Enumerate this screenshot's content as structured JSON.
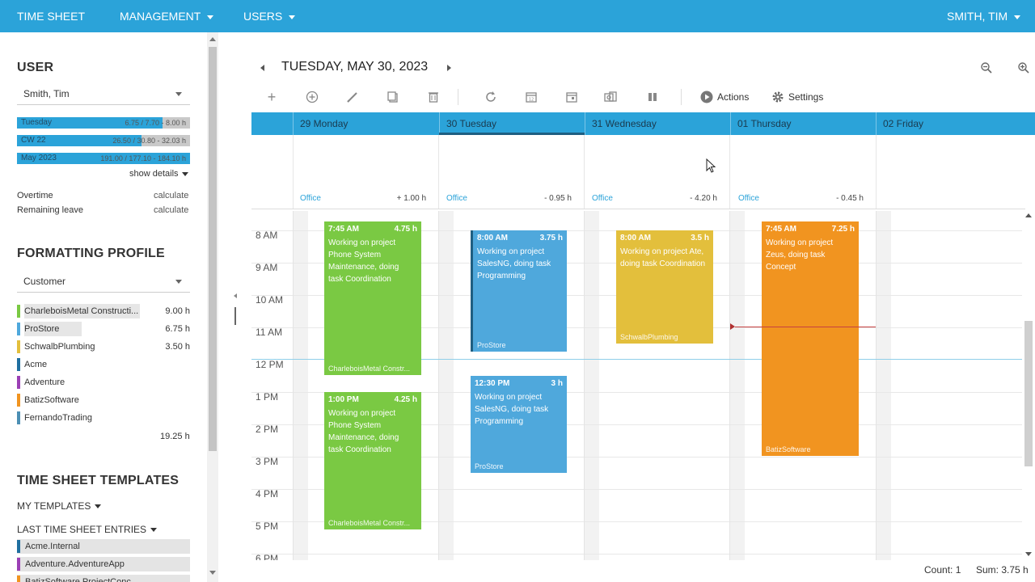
{
  "nav": {
    "timesheet": "TIME SHEET",
    "management": "MANAGEMENT",
    "users": "USERS",
    "user_menu": "SMITH, TIM"
  },
  "sidebar": {
    "user_title": "USER",
    "user_select": "Smith, Tim",
    "bars": [
      {
        "label": "Tuesday",
        "value": "6.75 / 7.70 - 8.00 h",
        "fill": 0.84
      },
      {
        "label": "CW 22",
        "value": "26.50 / 30.80 - 32.03 h",
        "fill": 0.72
      },
      {
        "label": "May 2023",
        "value": "191.00 / 177.10 - 184.10 h",
        "fill": 1.0
      }
    ],
    "show_details": "show details",
    "overtime_label": "Overtime",
    "overtime_value": "calculate",
    "leave_label": "Remaining leave",
    "leave_value": "calculate",
    "format_title": "FORMATTING PROFILE",
    "format_select": "Customer",
    "customers": [
      {
        "name": "CharleboisMetal Constructi...",
        "hours": "9.00 h",
        "color": "#7ac943"
      },
      {
        "name": "ProStore",
        "hours": "6.75 h",
        "color": "#4fa8dc"
      },
      {
        "name": "SchwalbPlumbing",
        "hours": "3.50 h",
        "color": "#e3bf3c"
      },
      {
        "name": "Acme",
        "hours": "",
        "color": "#1f6fa0"
      },
      {
        "name": "Adventure",
        "hours": "",
        "color": "#9b3fb5"
      },
      {
        "name": "BatizSoftware",
        "hours": "",
        "color": "#f19420"
      },
      {
        "name": "FernandoTrading",
        "hours": "",
        "color": "#4c8fb4"
      }
    ],
    "total_hours": "19.25 h",
    "templates_title": "TIME SHEET TEMPLATES",
    "my_templates": "MY TEMPLATES",
    "last_entries": "LAST TIME SHEET ENTRIES",
    "templates": [
      {
        "name": "Acme.Internal",
        "color": "#1f6fa0"
      },
      {
        "name": "Adventure.AdventureApp",
        "color": "#9b3fb5"
      },
      {
        "name": "BatizSoftware.ProjectConc...",
        "color": "#f19420"
      }
    ]
  },
  "calendar": {
    "date_title": "TUESDAY, MAY 30, 2023",
    "actions": "Actions",
    "settings": "Settings",
    "days": [
      {
        "label": "29 Monday",
        "office": "Office",
        "hours": "+ 1.00 h"
      },
      {
        "label": "30 Tuesday",
        "office": "Office",
        "hours": "- 0.95 h"
      },
      {
        "label": "31 Wednesday",
        "office": "Office",
        "hours": "- 4.20 h"
      },
      {
        "label": "01 Thursday",
        "office": "Office",
        "hours": "- 0.45 h"
      },
      {
        "label": "02 Friday",
        "office": "",
        "hours": ""
      }
    ],
    "hours": [
      "8 AM",
      "9 AM",
      "10 AM",
      "11 AM",
      "12 PM",
      "1 PM",
      "2 PM",
      "3 PM",
      "4 PM",
      "5 PM",
      "6 PM"
    ],
    "events": [
      {
        "day": 0,
        "time": "7:45 AM",
        "hours": "4.75 h",
        "desc": "Working on project Phone System Maintenance, doing task Coordination",
        "customer": "CharleboisMetal Constr...",
        "color": "#7ac943"
      },
      {
        "day": 0,
        "time": "1:00 PM",
        "hours": "4.25 h",
        "desc": "Working on project Phone System Maintenance, doing task Coordination",
        "customer": "CharleboisMetal Constr...",
        "color": "#7ac943"
      },
      {
        "day": 1,
        "time": "8:00 AM",
        "hours": "3.75 h",
        "desc": "Working on project SalesNG, doing task Programming",
        "customer": "ProStore",
        "color": "#4fa8dc"
      },
      {
        "day": 1,
        "time": "12:30 PM",
        "hours": "3 h",
        "desc": "Working on project SalesNG, doing task Programming",
        "customer": "ProStore",
        "color": "#4fa8dc"
      },
      {
        "day": 2,
        "time": "8:00 AM",
        "hours": "3.5 h",
        "desc": "Working on project Ate, doing task Coordination",
        "customer": "SchwalbPlumbing",
        "color": "#e3bf3c"
      },
      {
        "day": 3,
        "time": "7:45 AM",
        "hours": "7.25 h",
        "desc": "Working on project Zeus, doing task Concept",
        "customer": "BatizSoftware",
        "color": "#f19420"
      }
    ]
  },
  "status": {
    "count": "Count: 1",
    "sum": "Sum: 3.75 h"
  }
}
